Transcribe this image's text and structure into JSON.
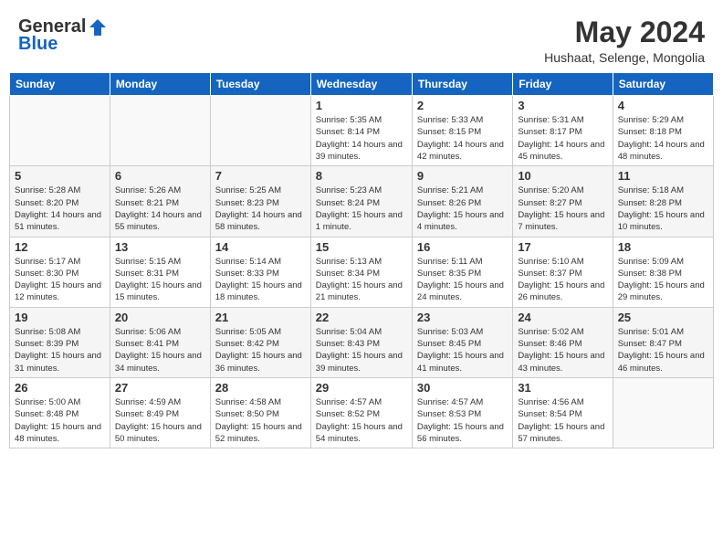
{
  "header": {
    "logo_general": "General",
    "logo_blue": "Blue",
    "month_year": "May 2024",
    "location": "Hushaat, Selenge, Mongolia"
  },
  "days_of_week": [
    "Sunday",
    "Monday",
    "Tuesday",
    "Wednesday",
    "Thursday",
    "Friday",
    "Saturday"
  ],
  "weeks": [
    [
      {
        "day": "",
        "info": ""
      },
      {
        "day": "",
        "info": ""
      },
      {
        "day": "",
        "info": ""
      },
      {
        "day": "1",
        "info": "Sunrise: 5:35 AM\nSunset: 8:14 PM\nDaylight: 14 hours and 39 minutes."
      },
      {
        "day": "2",
        "info": "Sunrise: 5:33 AM\nSunset: 8:15 PM\nDaylight: 14 hours and 42 minutes."
      },
      {
        "day": "3",
        "info": "Sunrise: 5:31 AM\nSunset: 8:17 PM\nDaylight: 14 hours and 45 minutes."
      },
      {
        "day": "4",
        "info": "Sunrise: 5:29 AM\nSunset: 8:18 PM\nDaylight: 14 hours and 48 minutes."
      }
    ],
    [
      {
        "day": "5",
        "info": "Sunrise: 5:28 AM\nSunset: 8:20 PM\nDaylight: 14 hours and 51 minutes."
      },
      {
        "day": "6",
        "info": "Sunrise: 5:26 AM\nSunset: 8:21 PM\nDaylight: 14 hours and 55 minutes."
      },
      {
        "day": "7",
        "info": "Sunrise: 5:25 AM\nSunset: 8:23 PM\nDaylight: 14 hours and 58 minutes."
      },
      {
        "day": "8",
        "info": "Sunrise: 5:23 AM\nSunset: 8:24 PM\nDaylight: 15 hours and 1 minute."
      },
      {
        "day": "9",
        "info": "Sunrise: 5:21 AM\nSunset: 8:26 PM\nDaylight: 15 hours and 4 minutes."
      },
      {
        "day": "10",
        "info": "Sunrise: 5:20 AM\nSunset: 8:27 PM\nDaylight: 15 hours and 7 minutes."
      },
      {
        "day": "11",
        "info": "Sunrise: 5:18 AM\nSunset: 8:28 PM\nDaylight: 15 hours and 10 minutes."
      }
    ],
    [
      {
        "day": "12",
        "info": "Sunrise: 5:17 AM\nSunset: 8:30 PM\nDaylight: 15 hours and 12 minutes."
      },
      {
        "day": "13",
        "info": "Sunrise: 5:15 AM\nSunset: 8:31 PM\nDaylight: 15 hours and 15 minutes."
      },
      {
        "day": "14",
        "info": "Sunrise: 5:14 AM\nSunset: 8:33 PM\nDaylight: 15 hours and 18 minutes."
      },
      {
        "day": "15",
        "info": "Sunrise: 5:13 AM\nSunset: 8:34 PM\nDaylight: 15 hours and 21 minutes."
      },
      {
        "day": "16",
        "info": "Sunrise: 5:11 AM\nSunset: 8:35 PM\nDaylight: 15 hours and 24 minutes."
      },
      {
        "day": "17",
        "info": "Sunrise: 5:10 AM\nSunset: 8:37 PM\nDaylight: 15 hours and 26 minutes."
      },
      {
        "day": "18",
        "info": "Sunrise: 5:09 AM\nSunset: 8:38 PM\nDaylight: 15 hours and 29 minutes."
      }
    ],
    [
      {
        "day": "19",
        "info": "Sunrise: 5:08 AM\nSunset: 8:39 PM\nDaylight: 15 hours and 31 minutes."
      },
      {
        "day": "20",
        "info": "Sunrise: 5:06 AM\nSunset: 8:41 PM\nDaylight: 15 hours and 34 minutes."
      },
      {
        "day": "21",
        "info": "Sunrise: 5:05 AM\nSunset: 8:42 PM\nDaylight: 15 hours and 36 minutes."
      },
      {
        "day": "22",
        "info": "Sunrise: 5:04 AM\nSunset: 8:43 PM\nDaylight: 15 hours and 39 minutes."
      },
      {
        "day": "23",
        "info": "Sunrise: 5:03 AM\nSunset: 8:45 PM\nDaylight: 15 hours and 41 minutes."
      },
      {
        "day": "24",
        "info": "Sunrise: 5:02 AM\nSunset: 8:46 PM\nDaylight: 15 hours and 43 minutes."
      },
      {
        "day": "25",
        "info": "Sunrise: 5:01 AM\nSunset: 8:47 PM\nDaylight: 15 hours and 46 minutes."
      }
    ],
    [
      {
        "day": "26",
        "info": "Sunrise: 5:00 AM\nSunset: 8:48 PM\nDaylight: 15 hours and 48 minutes."
      },
      {
        "day": "27",
        "info": "Sunrise: 4:59 AM\nSunset: 8:49 PM\nDaylight: 15 hours and 50 minutes."
      },
      {
        "day": "28",
        "info": "Sunrise: 4:58 AM\nSunset: 8:50 PM\nDaylight: 15 hours and 52 minutes."
      },
      {
        "day": "29",
        "info": "Sunrise: 4:57 AM\nSunset: 8:52 PM\nDaylight: 15 hours and 54 minutes."
      },
      {
        "day": "30",
        "info": "Sunrise: 4:57 AM\nSunset: 8:53 PM\nDaylight: 15 hours and 56 minutes."
      },
      {
        "day": "31",
        "info": "Sunrise: 4:56 AM\nSunset: 8:54 PM\nDaylight: 15 hours and 57 minutes."
      },
      {
        "day": "",
        "info": ""
      }
    ]
  ]
}
